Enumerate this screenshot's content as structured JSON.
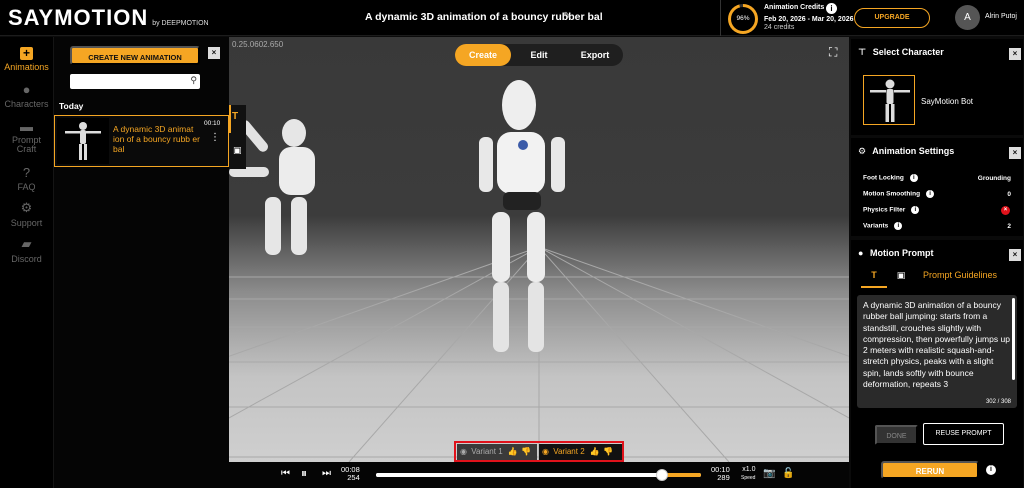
{
  "topbar": {
    "logo_text": "SAYMOTION",
    "logo_by": "by DEEPMOTION",
    "doc_title": "A dynamic 3D animation of a bouncy rubber bal",
    "credits_percent": "96%",
    "credits_title": "Animation Credits",
    "credits_dates": "Feb 20, 2026 - Mar 20, 2026",
    "credits_count": "24 credits",
    "upgrade_label": "UPGRADE",
    "avatar_initial": "A",
    "username": "Alrin Putoj"
  },
  "nav": {
    "items": [
      {
        "label": "Animations",
        "icon": "plus-icon"
      },
      {
        "label": "Characters",
        "icon": "person-icon"
      },
      {
        "label": "Prompt",
        "label2": "Craft",
        "icon": "prompt-icon"
      },
      {
        "label": "FAQ",
        "icon": "question-icon"
      },
      {
        "label": "Support",
        "icon": "gear-icon"
      },
      {
        "label": "Discord",
        "icon": "chat-icon"
      }
    ]
  },
  "animations": {
    "new_label": "CREATE NEW ANIMATION",
    "section_today": "Today",
    "items": [
      {
        "title": "A dynamic 3D animat ion of a bouncy rubb er bal",
        "duration": "00:10"
      }
    ]
  },
  "viewport": {
    "version": "0.25.0602.650",
    "tabs": [
      "Create",
      "Edit",
      "Export"
    ],
    "active_tab": "Create",
    "variants": [
      {
        "label": "Variant 1",
        "active": false
      },
      {
        "label": "Variant 2",
        "active": true
      }
    ]
  },
  "timeline": {
    "current_time": "00:08",
    "current_frame": "254",
    "end_time": "00:10",
    "end_frame": "289",
    "speed": "x1.0",
    "speed_sub": "Speed",
    "progress": 0.88
  },
  "right": {
    "select_character_title": "Select Character",
    "character_name": "SayMotion Bot",
    "settings_title": "Animation Settings",
    "settings": [
      {
        "label": "Foot Locking",
        "value": "Grounding"
      },
      {
        "label": "Motion Smoothing",
        "value": "0"
      },
      {
        "label": "Physics Filter",
        "value": ""
      },
      {
        "label": "Variants",
        "value": "2"
      }
    ],
    "prompt_title": "Motion Prompt",
    "prompt_guidelines": "Prompt Guidelines",
    "prompt_text": "A dynamic 3D animation of a bouncy rubber ball jumping: starts from a standstill, crouches slightly with compression, then powerfully jumps up 2 meters with realistic squash-and-stretch physics, peaks with a slight spin, lands softly with bounce deformation, repeats 3",
    "prompt_count": "302 / 308",
    "done_label": "DONE",
    "reuse_label": "REUSE PROMPT",
    "rerun_label": "RERUN"
  },
  "colors": {
    "accent": "#f5a623",
    "highlight_red": "#e0121b"
  }
}
